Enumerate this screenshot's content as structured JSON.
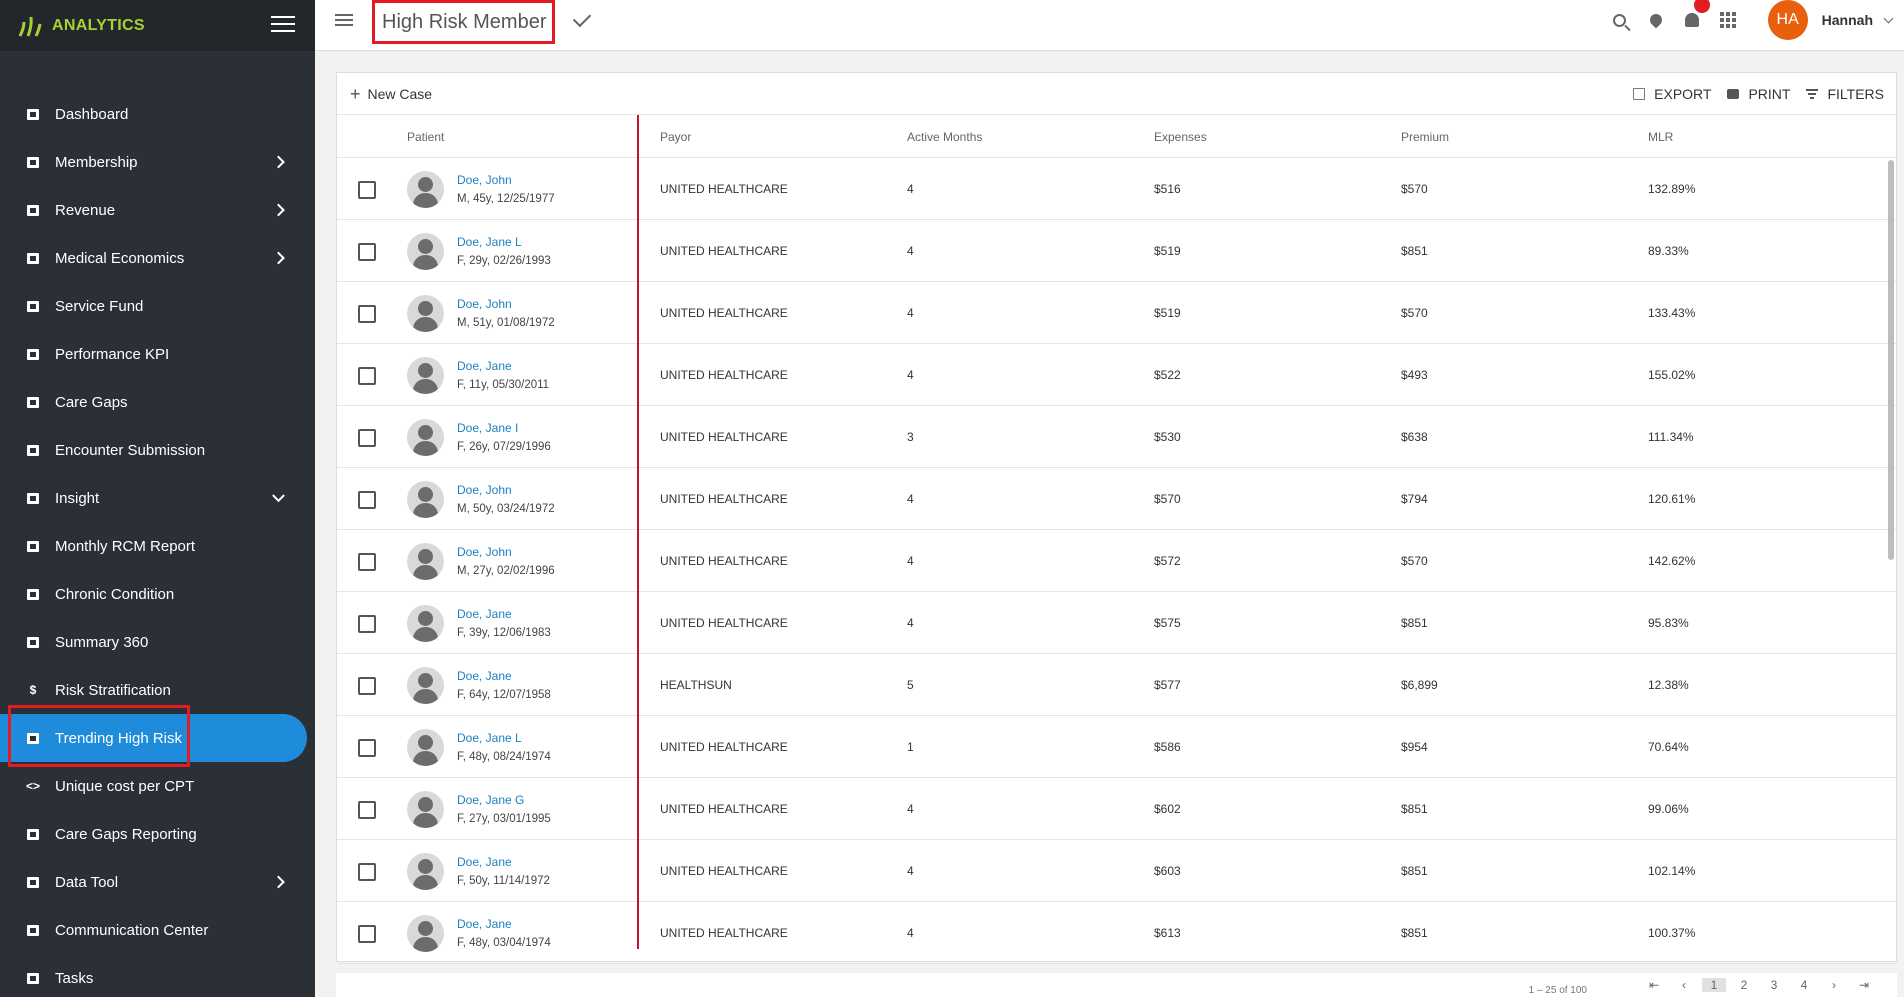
{
  "brand": {
    "name": "ANALYTICS",
    "accent": "#a6d133"
  },
  "sidebar": {
    "items": [
      {
        "label": "Dashboard",
        "icon": "dashboard-icon",
        "chevron": ""
      },
      {
        "label": "Membership",
        "icon": "membership-icon",
        "chevron": "right"
      },
      {
        "label": "Revenue",
        "icon": "revenue-icon",
        "chevron": "right"
      },
      {
        "label": "Medical Economics",
        "icon": "medical-economics-icon",
        "chevron": "right"
      },
      {
        "label": "Service Fund",
        "icon": "service-fund-icon",
        "chevron": ""
      },
      {
        "label": "Performance KPI",
        "icon": "chart-icon",
        "chevron": ""
      },
      {
        "label": "Care Gaps",
        "icon": "briefcase-icon",
        "chevron": ""
      },
      {
        "label": "Encounter Submission",
        "icon": "edit-icon",
        "chevron": ""
      },
      {
        "label": "Insight",
        "icon": "chart-icon",
        "chevron": "down"
      },
      {
        "label": "Monthly RCM Report",
        "icon": "chart-icon",
        "chevron": ""
      },
      {
        "label": "Chronic Condition",
        "icon": "chart-icon",
        "chevron": ""
      },
      {
        "label": "Summary 360",
        "icon": "document-icon",
        "chevron": ""
      },
      {
        "label": "Risk Stratification",
        "icon": "dollar-icon",
        "chevron": ""
      },
      {
        "label": "Trending High Risk",
        "icon": "monitor-icon",
        "chevron": "",
        "active": true
      },
      {
        "label": "Unique cost per CPT",
        "icon": "code-icon",
        "chevron": ""
      },
      {
        "label": "Care Gaps Reporting",
        "icon": "briefcase-icon",
        "chevron": ""
      },
      {
        "label": "Data Tool",
        "icon": "chart-icon",
        "chevron": "right"
      },
      {
        "label": "Communication Center",
        "icon": "contact-icon",
        "chevron": ""
      },
      {
        "label": "Tasks",
        "icon": "edit-icon",
        "chevron": ""
      }
    ]
  },
  "header": {
    "title": "High Risk Member",
    "user_initials": "HA",
    "user_name": "Hannah"
  },
  "toolbar": {
    "new_case": "New Case",
    "export": "EXPORT",
    "print": "PRINT",
    "filters": "FILTERS"
  },
  "table": {
    "columns": [
      "Patient",
      "Payor",
      "Active Months",
      "Expenses",
      "Premium",
      "MLR"
    ],
    "rows": [
      {
        "name": "Doe, John",
        "info": "M, 45y, 12/25/1977",
        "payor": "UNITED HEALTHCARE",
        "months": "4",
        "expenses": "$516",
        "premium": "$570",
        "mlr": "132.89%"
      },
      {
        "name": "Doe, Jane L",
        "info": "F, 29y, 02/26/1993",
        "payor": "UNITED HEALTHCARE",
        "months": "4",
        "expenses": "$519",
        "premium": "$851",
        "mlr": "89.33%"
      },
      {
        "name": "Doe, John",
        "info": "M, 51y, 01/08/1972",
        "payor": "UNITED HEALTHCARE",
        "months": "4",
        "expenses": "$519",
        "premium": "$570",
        "mlr": "133.43%"
      },
      {
        "name": "Doe, Jane",
        "info": "F, 11y, 05/30/2011",
        "payor": "UNITED HEALTHCARE",
        "months": "4",
        "expenses": "$522",
        "premium": "$493",
        "mlr": "155.02%"
      },
      {
        "name": "Doe, Jane I",
        "info": "F, 26y, 07/29/1996",
        "payor": "UNITED HEALTHCARE",
        "months": "3",
        "expenses": "$530",
        "premium": "$638",
        "mlr": "111.34%"
      },
      {
        "name": "Doe, John",
        "info": "M, 50y, 03/24/1972",
        "payor": "UNITED HEALTHCARE",
        "months": "4",
        "expenses": "$570",
        "premium": "$794",
        "mlr": "120.61%"
      },
      {
        "name": "Doe, John",
        "info": "M, 27y, 02/02/1996",
        "payor": "UNITED HEALTHCARE",
        "months": "4",
        "expenses": "$572",
        "premium": "$570",
        "mlr": "142.62%"
      },
      {
        "name": "Doe, Jane",
        "info": "F, 39y, 12/06/1983",
        "payor": "UNITED HEALTHCARE",
        "months": "4",
        "expenses": "$575",
        "premium": "$851",
        "mlr": "95.83%"
      },
      {
        "name": "Doe, Jane",
        "info": "F, 64y, 12/07/1958",
        "payor": "HEALTHSUN",
        "months": "5",
        "expenses": "$577",
        "premium": "$6,899",
        "mlr": "12.38%"
      },
      {
        "name": "Doe, Jane L",
        "info": "F, 48y, 08/24/1974",
        "payor": "UNITED HEALTHCARE",
        "months": "1",
        "expenses": "$586",
        "premium": "$954",
        "mlr": "70.64%"
      },
      {
        "name": "Doe, Jane G",
        "info": "F, 27y, 03/01/1995",
        "payor": "UNITED HEALTHCARE",
        "months": "4",
        "expenses": "$602",
        "premium": "$851",
        "mlr": "99.06%"
      },
      {
        "name": "Doe, Jane",
        "info": "F, 50y, 11/14/1972",
        "payor": "UNITED HEALTHCARE",
        "months": "4",
        "expenses": "$603",
        "premium": "$851",
        "mlr": "102.14%"
      },
      {
        "name": "Doe, Jane",
        "info": "F, 48y, 03/04/1974",
        "payor": "UNITED HEALTHCARE",
        "months": "4",
        "expenses": "$613",
        "premium": "$851",
        "mlr": "100.37%"
      }
    ]
  },
  "pagination": {
    "range": "1 – 25 of 100",
    "pages": [
      "1",
      "2",
      "3",
      "4"
    ],
    "current": "1"
  },
  "colors": {
    "active": "#1e8cdb",
    "highlight": "#e31b23",
    "link": "#1e7fc2",
    "divider": "#c8102e",
    "avatar": "#e8600c"
  }
}
